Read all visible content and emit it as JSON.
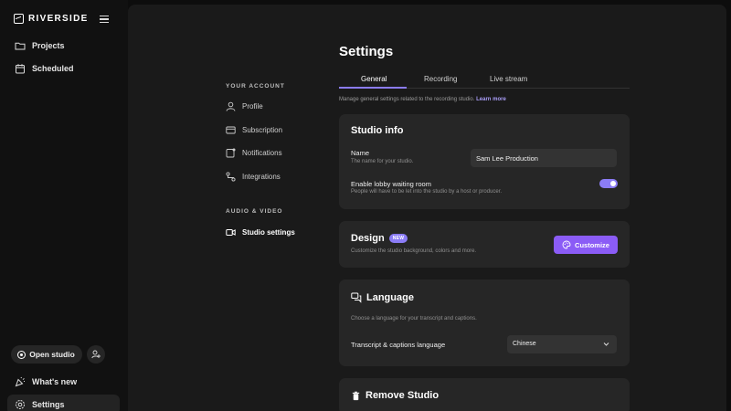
{
  "brand": {
    "name": "RIVERSIDE"
  },
  "sidebar": {
    "items": [
      {
        "label": "Projects",
        "icon": "folder-icon"
      },
      {
        "label": "Scheduled",
        "icon": "calendar-icon"
      }
    ],
    "open_studio_label": "Open studio",
    "whats_new_label": "What's new",
    "settings_label": "Settings"
  },
  "page": {
    "title": "Settings"
  },
  "settings_nav": {
    "account_header": "YOUR ACCOUNT",
    "account_items": [
      {
        "label": "Profile",
        "icon": "user-icon"
      },
      {
        "label": "Subscription",
        "icon": "credit-card-icon"
      },
      {
        "label": "Notifications",
        "icon": "bell-icon"
      },
      {
        "label": "Integrations",
        "icon": "integrations-icon"
      }
    ],
    "av_header": "AUDIO & VIDEO",
    "av_items": [
      {
        "label": "Studio settings",
        "icon": "video-icon",
        "active": true
      }
    ]
  },
  "tabs": [
    {
      "label": "General",
      "active": true
    },
    {
      "label": "Recording"
    },
    {
      "label": "Live stream"
    }
  ],
  "description": {
    "text": "Manage general settings related to the recording studio.",
    "link": "Learn more"
  },
  "studio_info": {
    "title": "Studio info",
    "name_label": "Name",
    "name_hint": "The name for your studio.",
    "name_value": "Sam Lee Production",
    "lobby_label": "Enable lobby waiting room",
    "lobby_hint": "People will have to be let into the studio by a host or producer.",
    "lobby_enabled": true
  },
  "design": {
    "title": "Design",
    "badge": "NEW",
    "hint": "Customize the studio background, colors and more.",
    "button": "Customize"
  },
  "language": {
    "title": "Language",
    "hint": "Choose a language for your transcript and captions.",
    "field_label": "Transcript & captions language",
    "selected": "Chinese"
  },
  "remove": {
    "title": "Remove Studio"
  },
  "colors": {
    "accent": "#8b7cf6",
    "button": "#8b5cf6",
    "background": "#0d0d0d",
    "card": "#262626"
  }
}
